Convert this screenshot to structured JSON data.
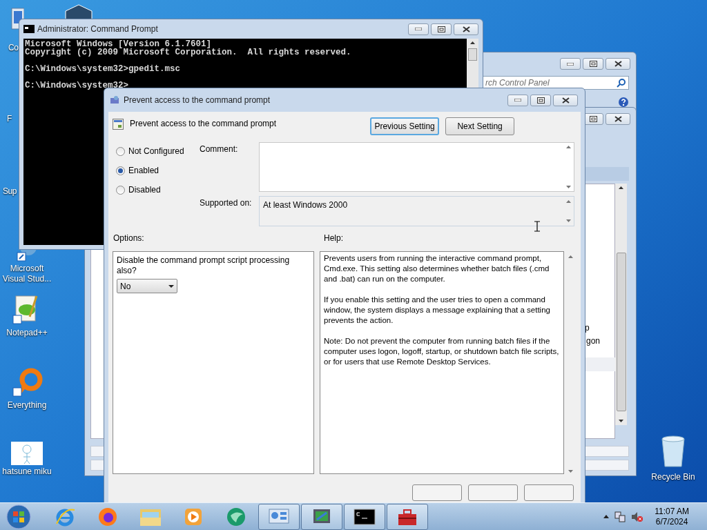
{
  "desktop_icons": [
    {
      "kind": "cut",
      "label": "Co"
    },
    {
      "kind": "cut",
      "label": "F"
    },
    {
      "kind": "cut",
      "label": "Sup"
    },
    {
      "kind": "vs",
      "label": "Microsoft Visual Stud..."
    },
    {
      "kind": "notepad",
      "label": "Notepad++"
    },
    {
      "kind": "everything",
      "label": "Everything"
    },
    {
      "kind": "miku",
      "label": "hatsune miku"
    }
  ],
  "recycle_bin": {
    "label": "Recycle Bin"
  },
  "control_panel_window": {
    "search": {
      "placeholder": "rch Control Panel"
    }
  },
  "back_window": {
    "fragments": [
      "p",
      "gon"
    ]
  },
  "cmd_window": {
    "title": "Administrator: Command Prompt",
    "blocks": [
      [
        "Microsoft Windows [Version 6.1.7601]",
        "Copyright (c) 2009 Microsoft Corporation.  All rights reserved."
      ],
      [
        "C:\\Windows\\system32>gpedit.msc"
      ],
      [
        "C:\\Windows\\system32>"
      ]
    ]
  },
  "policy_dialog": {
    "title": "Prevent access to the command prompt",
    "heading": "Prevent access to the command prompt",
    "buttons": [
      {
        "label": "Previous Setting",
        "focused": true
      },
      {
        "label": "Next Setting",
        "focused": false
      }
    ],
    "states": [
      {
        "label": "Not Configured",
        "selected": false
      },
      {
        "label": "Enabled",
        "selected": true
      },
      {
        "label": "Disabled",
        "selected": false
      }
    ],
    "comment_label": "Comment:",
    "supported_label": "Supported on:",
    "supported_value": "At least Windows 2000",
    "options_label": "Options:",
    "help_label": "Help:",
    "option": {
      "label": "Disable the command prompt script processing also?",
      "value": "No"
    },
    "help": [
      "Prevents users from running the interactive command prompt, Cmd.exe. This setting also determines whether batch files (.cmd and .bat) can run on the computer.",
      "If you enable this setting and the user tries to open a command window, the system displays a message explaining that a setting prevents the action.",
      "Note: Do not prevent the computer from running batch files if the computer uses logon, logoff, startup, or shutdown batch file scripts, or for users that use Remote Desktop Services."
    ]
  },
  "taskbar": {
    "apps": [
      {
        "kind": "ie",
        "running": false
      },
      {
        "kind": "firefox",
        "running": false
      },
      {
        "kind": "folder",
        "running": false
      },
      {
        "kind": "media",
        "running": false
      },
      {
        "kind": "globe",
        "running": false
      },
      {
        "kind": "panel",
        "running": true
      },
      {
        "kind": "monitor",
        "running": true
      },
      {
        "kind": "console",
        "running": true
      },
      {
        "kind": "toolbox",
        "running": true
      }
    ],
    "time": "11:07 AM",
    "date": "6/7/2024"
  }
}
